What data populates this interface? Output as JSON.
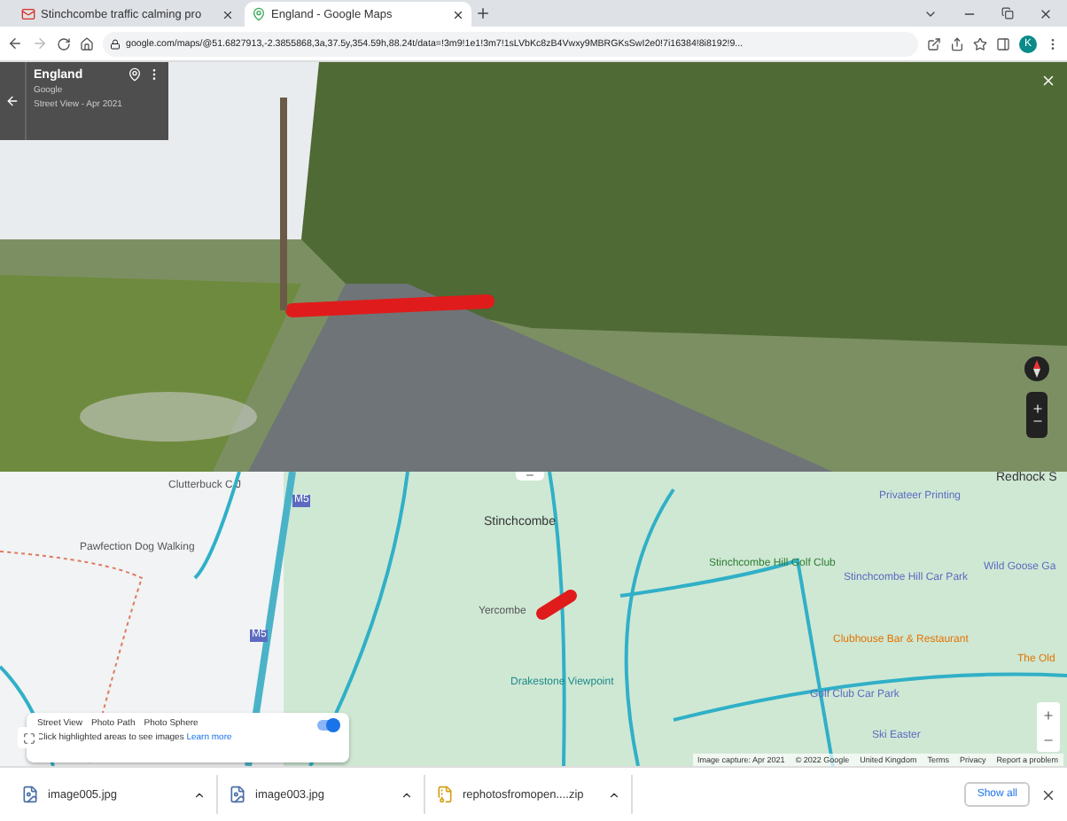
{
  "tabs": [
    {
      "title": "Stinchcombe traffic calming pro",
      "selected": false
    },
    {
      "title": "England - Google Maps",
      "selected": true
    }
  ],
  "address": "google.com/maps/@51.6827913,-2.3855868,3a,37.5y,354.59h,88.24t/data=!3m9!1e1!3m7!1sLVbKc8zB4Vwxy9MBRGKsSwI2e0!7i16384!8i8192!9...",
  "profile_initial": "K",
  "street_view": {
    "title": "England",
    "source": "Google",
    "date": "Street View - Apr 2021"
  },
  "map": {
    "labels": [
      {
        "text": "Clutterbuck C J",
        "kind": "poi"
      },
      {
        "text": "Pawfection Dog Walking",
        "kind": "poi"
      },
      {
        "text": "Stinchcombe",
        "kind": "place"
      },
      {
        "text": "Yercombe",
        "kind": "poi"
      },
      {
        "text": "Stinchcombe Hill Golf Club",
        "kind": "golf"
      },
      {
        "text": "Privateer Printing",
        "kind": "shop"
      },
      {
        "text": "Stinchcombe Hill Car Park",
        "kind": "parking"
      },
      {
        "text": "Redhock S",
        "kind": "place"
      },
      {
        "text": "Wild Goose Ga",
        "kind": "shop"
      },
      {
        "text": "Clubhouse Bar & Restaurant",
        "kind": "food"
      },
      {
        "text": "The Old",
        "kind": "food"
      },
      {
        "text": "Drakestone Viewpoint",
        "kind": "view"
      },
      {
        "text": "Golf Club Car Park",
        "kind": "parking"
      },
      {
        "text": "Ski Easter",
        "kind": "shop"
      },
      {
        "text": "M5",
        "kind": "road"
      },
      {
        "text": "M5",
        "kind": "road"
      }
    ],
    "legend": {
      "items": [
        "Street View",
        "Photo Path",
        "Photo Sphere"
      ],
      "hint": "Click highlighted areas to see images",
      "link": "Learn more",
      "toggle_on": true
    },
    "attribution": [
      "Image capture: Apr 2021",
      "© 2022 Google",
      "United Kingdom",
      "Terms",
      "Privacy",
      "Report a problem"
    ]
  },
  "downloads": [
    {
      "name": "image005.jpg",
      "kind": "image"
    },
    {
      "name": "image003.jpg",
      "kind": "image"
    },
    {
      "name": "rephotosfromopen....zip",
      "kind": "zip"
    }
  ],
  "show_all": "Show all"
}
